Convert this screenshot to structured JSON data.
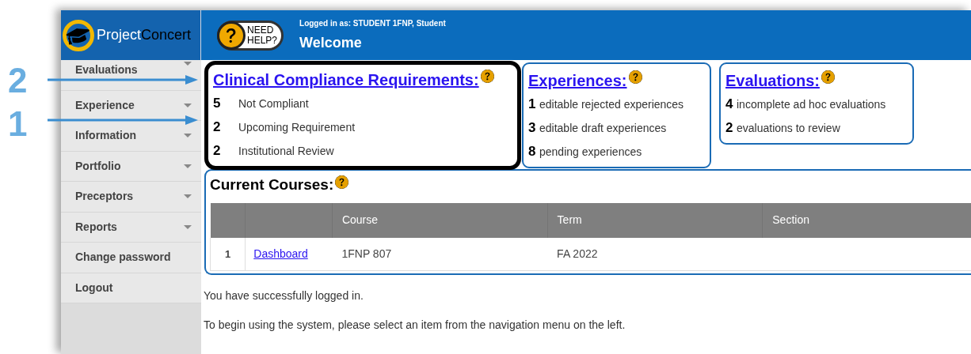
{
  "annotations": [
    {
      "label": "2"
    },
    {
      "label": "1"
    }
  ],
  "logo": {
    "part_1": "Project",
    "part_2": "Concert"
  },
  "sidebar": {
    "items": [
      {
        "label": "Evaluations",
        "expandable": true
      },
      {
        "label": "Experience",
        "expandable": true
      },
      {
        "label": "Information",
        "expandable": true
      },
      {
        "label": "Portfolio",
        "expandable": true
      },
      {
        "label": "Preceptors",
        "expandable": true
      },
      {
        "label": "Reports",
        "expandable": true
      },
      {
        "label": "Change password",
        "expandable": false
      },
      {
        "label": "Logout",
        "expandable": false
      }
    ]
  },
  "header": {
    "help_button": {
      "line_1": "NEED",
      "line_2": "HELP?"
    },
    "logged_in_as": "Logged in as: STUDENT 1FNP, Student",
    "title": "Welcome"
  },
  "sections": [
    {
      "title": "Clinical Compliance Requirements:",
      "highlighted": true,
      "rows": [
        {
          "count": "5",
          "label": "Not Compliant"
        },
        {
          "count": "2",
          "label": "Upcoming Requirement"
        },
        {
          "count": "2",
          "label": "Institutional Review"
        }
      ]
    },
    {
      "title": "Experiences:",
      "highlighted": false,
      "rows": [
        {
          "count": "1",
          "label": "editable rejected experiences"
        },
        {
          "count": "3",
          "label": "editable draft experiences"
        },
        {
          "count": "8",
          "label": "pending experiences"
        }
      ]
    },
    {
      "title": "Evaluations:",
      "highlighted": false,
      "rows": [
        {
          "count": "4",
          "label": "incomplete ad hoc evaluations"
        },
        {
          "count": "2",
          "label": "evaluations to review"
        }
      ]
    }
  ],
  "courses": {
    "title": "Current Courses:",
    "columns": [
      "Course",
      "Term",
      "Section"
    ],
    "rows": [
      {
        "index": "1",
        "link": "Dashboard",
        "course": "1FNP 807",
        "term": "FA 2022"
      }
    ]
  },
  "messages": [
    "You have successfully logged in.",
    "To begin using the system, please select an item from the navigation menu on the left."
  ]
}
